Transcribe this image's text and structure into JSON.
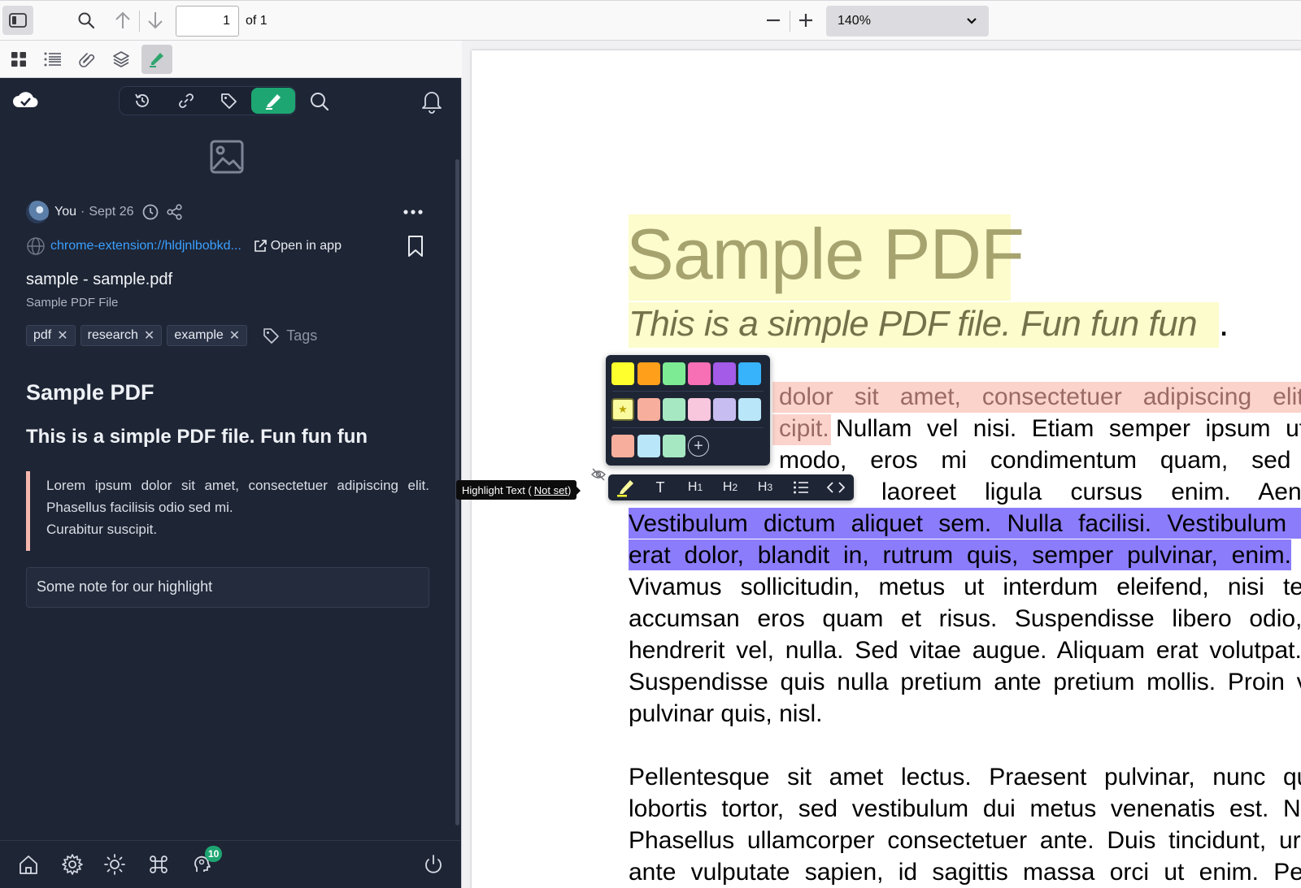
{
  "toolbar": {
    "page_number": "1",
    "page_of": "of 1",
    "zoom_value": "140%"
  },
  "sidebar_tabs": [
    "thumbnails",
    "outline",
    "attachments",
    "layers",
    "highlights"
  ],
  "panel": {
    "tabs": [
      "history",
      "links",
      "tags",
      "highlights"
    ],
    "active_tab": "highlights",
    "author": "You",
    "separator": "·",
    "date": "Sept 26",
    "source_url": "chrome-extension://hldjnlbobkd...",
    "open_in_app": "Open in app",
    "title": "sample - sample.pdf",
    "subtitle": "Sample PDF File",
    "tags": [
      {
        "label": "pdf",
        "remove": "✕"
      },
      {
        "label": "research",
        "remove": "✕"
      },
      {
        "label": "example",
        "remove": "✕"
      }
    ],
    "tags_placeholder": "Tags",
    "highlight_title": "Sample PDF",
    "highlight_subtitle": "This is a simple PDF file. Fun fun fun",
    "quote_lines": [
      "Lorem ipsum dolor sit amet, consectetuer adipiscing elit. Phasellus facilisis odio sed mi.",
      "Curabitur suscipit."
    ],
    "note": "Some note for our highlight",
    "notification_count": "10"
  },
  "pdf": {
    "title": "Sample PDF",
    "subtitle": "This is a simple PDF file. Fun fun fun",
    "subtitle_end": ".",
    "lines": [
      "dolor sit amet, consectetuer adipiscing elit. P",
      "cipit.",
      "Nullam vel nisi. Etiam semper ipsum ut le",
      "modo, eros mi condimentum quam, sed co",
      "laoreet ligula cursus enim. Aenear",
      "Vestibulum dictum aliquet sem. Nulla facilisi. Vestibulum ac",
      "erat dolor, blandit in, rutrum quis, semper pulvinar, enim.",
      "Vivamus sollicitudin, metus ut interdum eleifend, nisi tellu",
      "accumsan eros quam et risus. Suspendisse libero odio, r",
      "hendrerit vel, nulla. Sed vitae augue. Aliquam erat volutpat. A",
      "Suspendisse quis nulla pretium ante pretium mollis. Proin vel",
      "pulvinar quis, nisl.",
      "Pellentesque sit amet lectus. Praesent pulvinar, nunc quis",
      "lobortis tortor, sed vestibulum dui metus venenatis est. Nun",
      "Phasellus ullamcorper consectetuer ante. Duis tincidunt, urna",
      "ante vulputate sapien, id sagittis massa orci ut enim. Pelle"
    ]
  },
  "palette": {
    "row1": [
      "#ffff2e",
      "#ff9f1a",
      "#7deb93",
      "#f76fb4",
      "#a35be8",
      "#36b3fb"
    ],
    "row2": [
      "#fafa9e",
      "#f7ae9c",
      "#a6e8c2",
      "#f8c6dd",
      "#c8bdf0",
      "#b9e6f8"
    ],
    "row3": [
      "#f7ae9c",
      "#b9e6f8",
      "#a6e8c2"
    ],
    "selected_mark": "★",
    "add_label": "+"
  },
  "format_bar": {
    "text": "T",
    "h1": "H",
    "h2": "H",
    "h3": "H",
    "h1_sub": "1",
    "h2_sub": "2",
    "h3_sub": "3"
  },
  "tooltip": {
    "label": "Highlight Text (",
    "shortcut": "Not set",
    "close": ")"
  },
  "colors": {
    "accent": "#1ea672",
    "panel_bg": "#1e2535",
    "link": "#3aa0ff",
    "title_highlight": "#fcfccd",
    "pink_highlight": "#fbd3cb",
    "purple_highlight": "#8b7cfb"
  }
}
